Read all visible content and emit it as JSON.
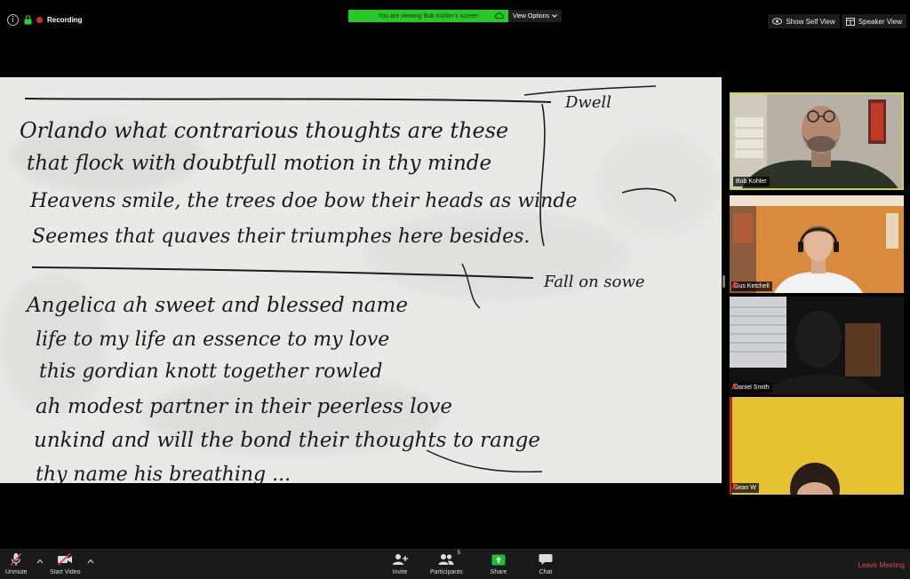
{
  "top_bar": {
    "recording_label": "Recording",
    "share_banner": "You are viewing Bob Kohler's screen",
    "view_options_label": "View Options",
    "show_self_view_label": "Show Self View",
    "speaker_view_label": "Speaker View"
  },
  "shared_screen": {
    "handwriting_lines": [
      "Orlando what contrarious thoughts are these",
      "that flock with doubtfull motion in thy minde",
      "Heavens smile, the trees doe bow their heads as winde",
      "Seemes that quaves their triumphes here besides.",
      "Angelica ah sweet and blessed name",
      "life to my life an essence to my love",
      "this gordian knott together rowled",
      "ah modest partner in their peerless love",
      "unkind and will the bond their thoughts to range",
      "thy name his breathing ..."
    ],
    "margin_notes": [
      "Dwell",
      "Fall on sowe"
    ]
  },
  "participants": [
    {
      "name": "Bob Kohler",
      "active": true,
      "muted": false
    },
    {
      "name": "Gus Ketchell",
      "active": false,
      "muted": true
    },
    {
      "name": "Daniel Smith",
      "active": false,
      "muted": true
    },
    {
      "name": "Sean W",
      "active": false,
      "muted": true
    }
  ],
  "toolbar": {
    "unmute_label": "Unmute",
    "start_video_label": "Start Video",
    "invite_label": "Invite",
    "participants_label": "Participants",
    "participants_count": "5",
    "share_label": "Share",
    "chat_label": "Chat",
    "leave_label": "Leave Meeting"
  },
  "colors": {
    "share_banner": "#27c927",
    "active_speaker_border": "#c9d44a",
    "leave_meeting": "#e5484d",
    "recording_dot": "#e02828",
    "share_icon": "#1fbf3a"
  }
}
